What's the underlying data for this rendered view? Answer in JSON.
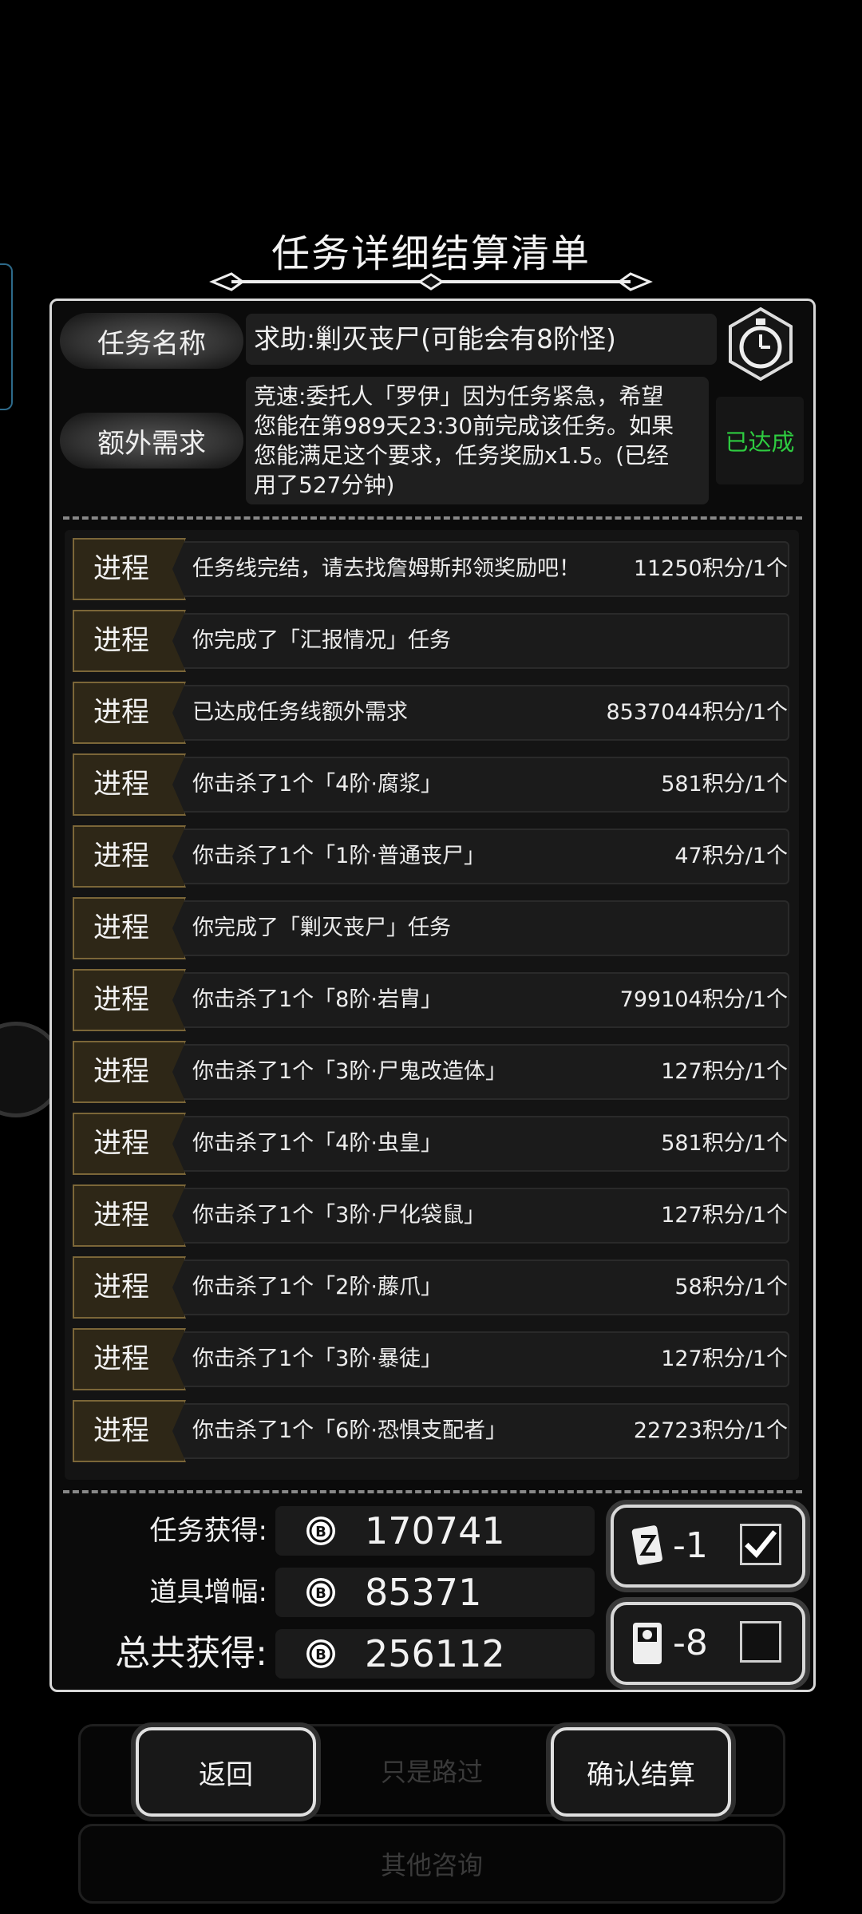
{
  "background": {
    "button_1": "只是路过",
    "button_2": "其他咨询"
  },
  "title": "任务详细结算清单",
  "mission": {
    "name_label": "任务名称",
    "name": "求助:剿灭丧尸(可能会有8阶怪)",
    "extra_label": "额外需求",
    "extra_lines": [
      "竞速:委托人「罗伊」因为任务紧急，希望",
      "您能在第989天23:30前完成该任务。如果",
      "您能满足这个要求，任务奖励x1.5。(已经",
      "用了527分钟)"
    ],
    "status": "已达成"
  },
  "rows": [
    {
      "tag": "进程",
      "desc": "任务线完结，请去找詹姆斯邦领奖励吧！",
      "pts": "11250积分/1个"
    },
    {
      "tag": "进程",
      "desc": "你完成了「汇报情况」任务",
      "pts": ""
    },
    {
      "tag": "进程",
      "desc": "已达成任务线额外需求",
      "pts": "8537044积分/1个"
    },
    {
      "tag": "进程",
      "desc": "你击杀了1个「4阶·腐浆」",
      "pts": "581积分/1个"
    },
    {
      "tag": "进程",
      "desc": "你击杀了1个「1阶·普通丧尸」",
      "pts": "47积分/1个"
    },
    {
      "tag": "进程",
      "desc": "你完成了「剿灭丧尸」任务",
      "pts": ""
    },
    {
      "tag": "进程",
      "desc": "你击杀了1个「8阶·岩胄」",
      "pts": "799104积分/1个"
    },
    {
      "tag": "进程",
      "desc": "你击杀了1个「3阶·尸鬼改造体」",
      "pts": "127积分/1个"
    },
    {
      "tag": "进程",
      "desc": "你击杀了1个「4阶·虫皇」",
      "pts": "581积分/1个"
    },
    {
      "tag": "进程",
      "desc": "你击杀了1个「3阶·尸化袋鼠」",
      "pts": "127积分/1个"
    },
    {
      "tag": "进程",
      "desc": "你击杀了1个「2阶·藤爪」",
      "pts": "58积分/1个"
    },
    {
      "tag": "进程",
      "desc": "你击杀了1个「3阶·暴徒」",
      "pts": "127积分/1个"
    },
    {
      "tag": "进程",
      "desc": "你击杀了1个「6阶·恐惧支配者」",
      "pts": "22723积分/1个"
    }
  ],
  "summary": {
    "task_label": "任务获得:",
    "task_value": "170741",
    "item_label": "道具增幅:",
    "item_value": "85371",
    "total_label": "总共获得:",
    "total_value": "256112"
  },
  "items": [
    {
      "count": "-1",
      "checked": true
    },
    {
      "count": "-8",
      "checked": false
    }
  ],
  "buttons": {
    "back": "返回",
    "confirm": "确认结算"
  }
}
